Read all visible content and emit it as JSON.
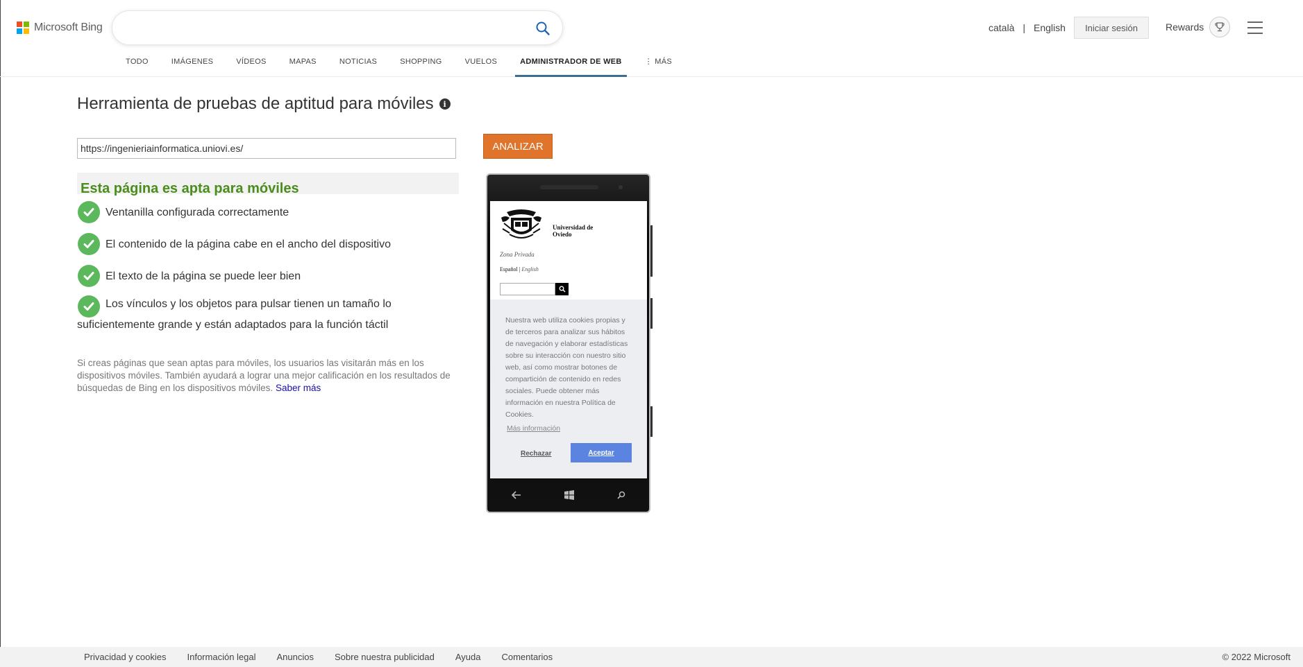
{
  "header": {
    "logo_text": "Microsoft Bing",
    "search_value": "",
    "lang_catalan": "català",
    "lang_sep": "|",
    "lang_english": "English",
    "signin_label": "Iniciar sesión",
    "rewards_label": "Rewards"
  },
  "nav": {
    "items": [
      {
        "label": "TODO"
      },
      {
        "label": "IMÁGENES"
      },
      {
        "label": "VÍDEOS"
      },
      {
        "label": "MAPAS"
      },
      {
        "label": "NOTICIAS"
      },
      {
        "label": "SHOPPING"
      },
      {
        "label": "VUELOS"
      },
      {
        "label": "ADMINISTRADOR DE WEB"
      },
      {
        "label": "⋮ MÁS"
      }
    ],
    "active_index": 7,
    "active_color": "#3b6f8f"
  },
  "tool": {
    "title": "Herramienta de pruebas de aptitud para móviles",
    "url_value": "https://ingenieriainformatica.uniovi.es/",
    "analyze_label": "ANALIZAR",
    "analyze_color": "#e0742a"
  },
  "result": {
    "heading": "Esta página es apta para móviles",
    "heading_color": "#4a8d1c",
    "checks": [
      "Ventanilla configurada correctamente",
      "El contenido de la página cabe en el ancho del dispositivo",
      "El texto de la página se puede leer bien",
      "Los vínculos y los objetos para pulsar tienen un tamaño lo suficientemente grande y están adaptados para la función táctil"
    ],
    "check_color": "#5cb85c",
    "note": "Si creas páginas que sean aptas para móviles, los usuarios las visitarán más en los dispositivos móviles. También ayudará a lograr una mejor calificación en los resultados de búsquedas de Bing en los dispositivos móviles.",
    "note_link": "Saber más"
  },
  "preview": {
    "uni_name_line1": "Universidad de",
    "uni_name_line2": "Oviedo",
    "zona": "Zona Privada",
    "lang_es": "Español",
    "lang_sep": "|",
    "lang_en": "English",
    "cookie_text": "Nuestra web utiliza cookies propias y de terceros para analizar sus hábitos de navegación y elaborar estadísticas sobre su interacción con nuestro sitio web, así como mostrar botones de compartición de contenido en redes sociales. Puede obtener más información en nuestra Política de Cookies.",
    "cookie_more": "Más información",
    "cookie_reject": "Rechazar",
    "cookie_accept": "Aceptar"
  },
  "footer": {
    "links": [
      "Privacidad y cookies",
      "Información legal",
      "Anuncios",
      "Sobre nuestra publicidad",
      "Ayuda",
      "Comentarios"
    ],
    "copyright": "© 2022 Microsoft"
  }
}
